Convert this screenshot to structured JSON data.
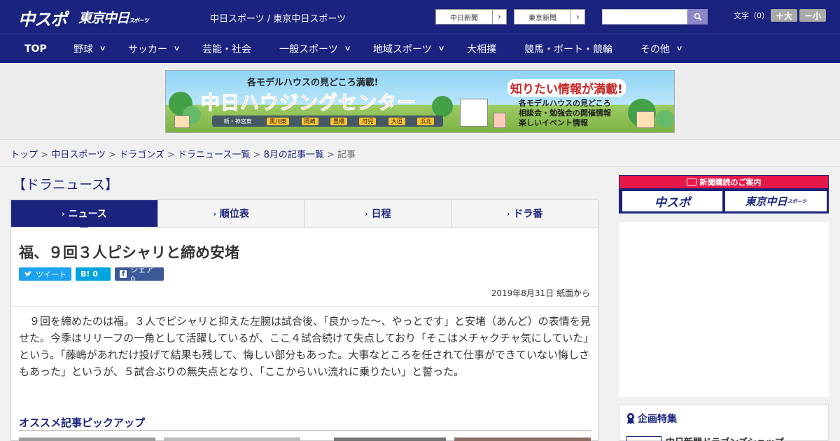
{
  "header": {
    "logo_chuspo": "中スポ",
    "logo_tokyo": "東京中日",
    "logo_tokyo_small": "スポーツ",
    "tagline": "中日スポーツ / 東京中日スポーツ",
    "paper_buttons": [
      "中日新聞",
      "東京新聞"
    ],
    "text_size_label": "文字（0）",
    "size_up": "＋大",
    "size_down": "－小"
  },
  "nav": {
    "items": [
      {
        "label": "TOP"
      },
      {
        "label": "野球"
      },
      {
        "label": "サッカー"
      },
      {
        "label": "芸能・社会"
      },
      {
        "label": "一般スポーツ"
      },
      {
        "label": "地域スポーツ"
      },
      {
        "label": "大相撲"
      },
      {
        "label": "競馬・ボート・競輪"
      },
      {
        "label": "その他"
      }
    ]
  },
  "ad": {
    "top_line": "各モデルハウスの見どころ満載!",
    "main_title": "中日ハウジングセンター",
    "locations": [
      "新・神宮東",
      "黒川東",
      "岡崎",
      "豊橋",
      "可児",
      "大垣",
      "浜北"
    ],
    "right_title": "知りたい情報が満載!",
    "right_lines": [
      "各モデルハウスの見どころ",
      "相談会・勉強会の開催情報",
      "楽しいイベント情報"
    ]
  },
  "breadcrumb": {
    "links": [
      "トップ",
      "中日スポーツ",
      "ドラゴンズ",
      "ドラニュース一覧",
      "8月の記事一覧"
    ],
    "current": "記事"
  },
  "section_title": "【ドラニュース】",
  "tabs": [
    {
      "label": "ニュース",
      "active": true
    },
    {
      "label": "順位表",
      "active": false
    },
    {
      "label": "日程",
      "active": false
    },
    {
      "label": "ドラ番",
      "active": false
    }
  ],
  "article": {
    "headline": "福、９回３人ピシャリと締め安堵",
    "share": {
      "tweet": "ツイート",
      "hatena": "B! 0",
      "facebook": "シェア 0"
    },
    "date": "2019年8月31日 紙面から",
    "body": "９回を締めたのは福。３人でピシャリと抑えた左腕は試合後、「良かった～、やっとです」と安堵（あんど）の表情を見せた。今季はリリーフの一角として活躍しているが、ここ４試合続けて失点しており「そこはメチャクチャ気にしていた」という。「藤嶋があれだけ投げて結果も残して、悔しい部分もあった。大事なところを任されて仕事ができていない悔しさもあった」というが、５試合ぶりの無失点となり、「ここからいい流れに乗りたい」と誓った。",
    "pickup_title": "オススメ記事ピックアップ"
  },
  "sidebar": {
    "subscribe_label": "新聞購読のご案内",
    "subscribe_logos": [
      "中スポ",
      "東京中日"
    ],
    "subscribe_logo_small": "スポーツ",
    "feature_title": "企画特集",
    "feature_item": "中日新聞ドラゴンズショップ"
  },
  "colors": {
    "brand_navy": "#1a237e",
    "subscribe_red": "#e8174a",
    "twitter": "#1da1f2",
    "hatena": "#00a4de",
    "facebook": "#3b5998"
  }
}
